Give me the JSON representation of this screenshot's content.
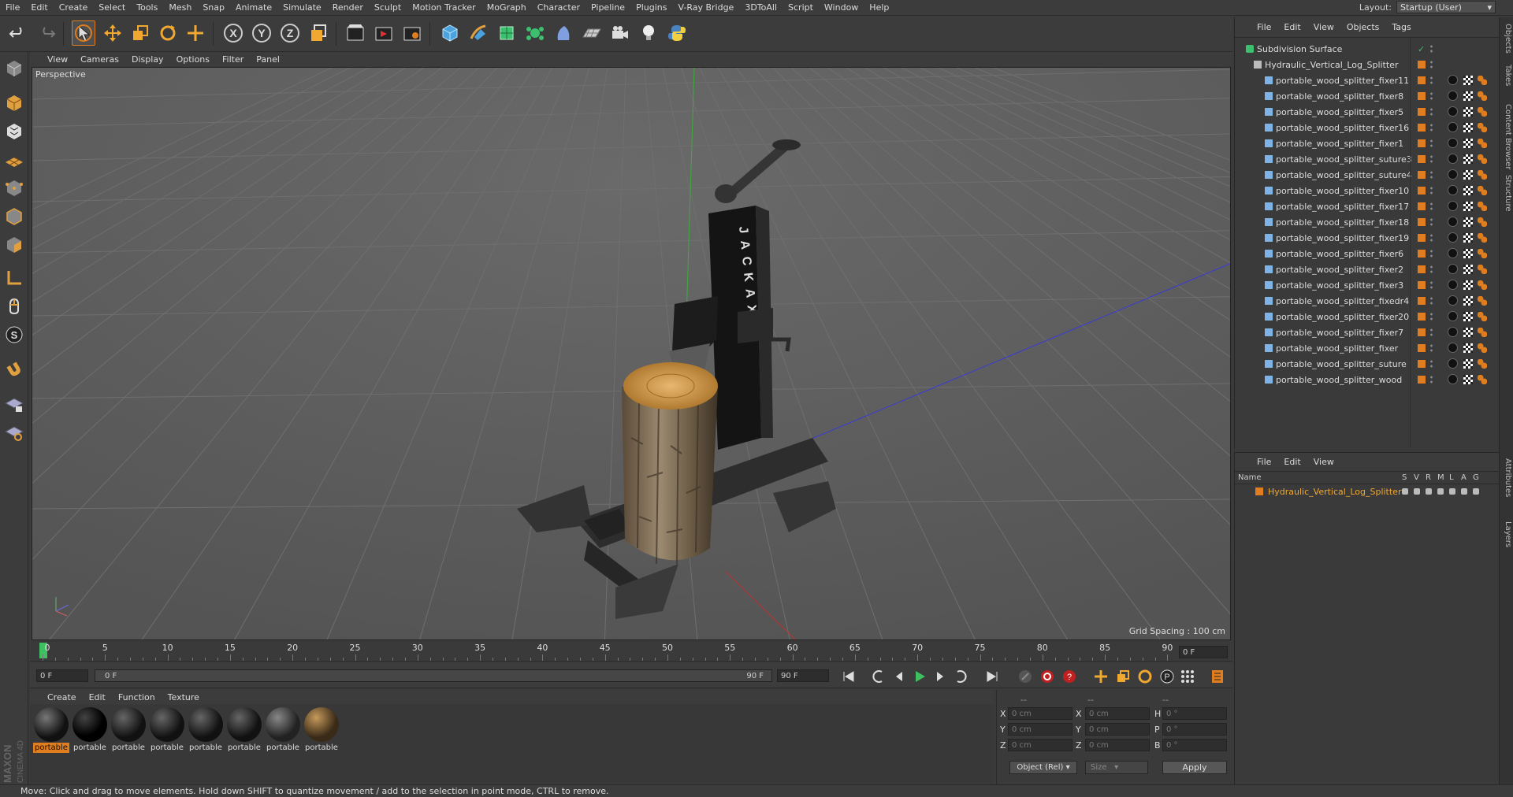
{
  "menu": [
    "File",
    "Edit",
    "Create",
    "Select",
    "Tools",
    "Mesh",
    "Snap",
    "Animate",
    "Simulate",
    "Render",
    "Sculpt",
    "Motion Tracker",
    "MoGraph",
    "Character",
    "Pipeline",
    "Plugins",
    "V-Ray Bridge",
    "3DToAll",
    "Script",
    "Window",
    "Help"
  ],
  "layout": {
    "label": "Layout:",
    "value": "Startup (User)"
  },
  "toolbar_icons": [
    "undo-icon",
    "redo-icon",
    "live-selection-icon",
    "move-icon",
    "scale-icon",
    "rotate-icon",
    "create-tool-icon",
    "x-axis-icon",
    "y-axis-icon",
    "z-axis-icon",
    "coordinate-system-icon",
    "render-view-icon",
    "render-picture-viewer-icon",
    "edit-render-settings-icon",
    "cube-icon",
    "pen-icon",
    "subdivision-icon",
    "cloner-icon",
    "deformer-icon",
    "floor-icon",
    "camera-icon",
    "light-icon",
    "python-icon"
  ],
  "axis_letters": [
    "X",
    "Y",
    "Z"
  ],
  "viewport": {
    "menu": [
      "View",
      "Cameras",
      "Display",
      "Options",
      "Filter",
      "Panel"
    ],
    "label": "Perspective",
    "grid_spacing": "Grid Spacing : 100 cm",
    "brand_text": "JACKAXX"
  },
  "timeline": {
    "ticks": [
      "0",
      "5",
      "10",
      "15",
      "20",
      "25",
      "30",
      "35",
      "40",
      "45",
      "50",
      "55",
      "60",
      "65",
      "70",
      "75",
      "80",
      "85",
      "90"
    ],
    "current_frame": "0 F",
    "start_field": "0 F",
    "range_start": "0 F",
    "range_end": "90 F",
    "end_field": "90 F",
    "right_field": "0 F"
  },
  "materials": {
    "menu": [
      "Create",
      "Edit",
      "Function",
      "Texture"
    ],
    "items": [
      {
        "label": "portable",
        "selected": true
      },
      {
        "label": "portable",
        "selected": false
      },
      {
        "label": "portable",
        "selected": false
      },
      {
        "label": "portable",
        "selected": false
      },
      {
        "label": "portable",
        "selected": false
      },
      {
        "label": "portable",
        "selected": false
      },
      {
        "label": "portable",
        "selected": false
      },
      {
        "label": "portable",
        "selected": false
      }
    ]
  },
  "coords": {
    "header": [
      "--",
      "--",
      "--"
    ],
    "rows": [
      {
        "l1": "X",
        "v1": "0 cm",
        "l2": "X",
        "v2": "0 cm",
        "l3": "H",
        "v3": "0 °"
      },
      {
        "l1": "Y",
        "v1": "0 cm",
        "l2": "Y",
        "v2": "0 cm",
        "l3": "P",
        "v3": "0 °"
      },
      {
        "l1": "Z",
        "v1": "0 cm",
        "l2": "Z",
        "v2": "0 cm",
        "l3": "B",
        "v3": "0 °"
      }
    ],
    "mode": "Object (Rel)",
    "size": "Size",
    "apply": "Apply"
  },
  "status": "Move: Click and drag to move elements. Hold down SHIFT to quantize movement / add to the selection in point mode, CTRL to remove.",
  "objects": {
    "menu": [
      "File",
      "Edit",
      "View",
      "Objects",
      "Tags"
    ],
    "root": "Subdivision Surface",
    "group": "Hydraulic_Vertical_Log_Splitter",
    "children": [
      "portable_wood_splitter_fixer11",
      "portable_wood_splitter_fixer8",
      "portable_wood_splitter_fixer5",
      "portable_wood_splitter_fixer16",
      "portable_wood_splitter_fixer1",
      "portable_wood_splitter_suture3",
      "portable_wood_splitter_suture4",
      "portable_wood_splitter_fixer10",
      "portable_wood_splitter_fixer17",
      "portable_wood_splitter_fixer18",
      "portable_wood_splitter_fixer19",
      "portable_wood_splitter_fixer6",
      "portable_wood_splitter_fixer2",
      "portable_wood_splitter_fixer3",
      "portable_wood_splitter_fixedr4",
      "portable_wood_splitter_fixer20",
      "portable_wood_splitter_fixer7",
      "portable_wood_splitter_fixer",
      "portable_wood_splitter_suture",
      "portable_wood_splitter_wood"
    ]
  },
  "layers": {
    "menu": [
      "File",
      "Edit",
      "View"
    ],
    "columns": [
      "Name",
      "S",
      "V",
      "R",
      "M",
      "L",
      "A",
      "G"
    ],
    "rows": [
      "Hydraulic_Vertical_Log_Splitter"
    ]
  },
  "side_tabs": [
    "Objects",
    "Takes",
    "Content Browser",
    "Structure",
    "Attributes",
    "Layers"
  ],
  "brand": {
    "line1": "MAXON",
    "line2": "CINEMA 4D"
  },
  "colors": {
    "accent": "#e07d1e",
    "bg": "#3a3a3a",
    "viewport": "#5e5e5e"
  }
}
